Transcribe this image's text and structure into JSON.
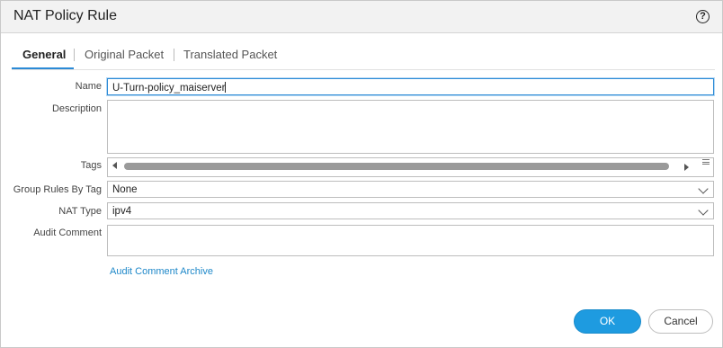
{
  "dialog": {
    "title": "NAT Policy Rule",
    "help_icon": "?"
  },
  "tabs": [
    {
      "label": "General",
      "active": true
    },
    {
      "label": "Original Packet",
      "active": false
    },
    {
      "label": "Translated Packet",
      "active": false
    }
  ],
  "form": {
    "name_label": "Name",
    "name_value": "U-Turn-policy_maiserver",
    "description_label": "Description",
    "description_value": "",
    "tags_label": "Tags",
    "group_rules_label": "Group Rules By Tag",
    "group_rules_value": "None",
    "nat_type_label": "NAT Type",
    "nat_type_value": "ipv4",
    "audit_comment_label": "Audit Comment",
    "audit_comment_value": "",
    "audit_archive_link": "Audit Comment Archive"
  },
  "buttons": {
    "ok_label": "OK",
    "cancel_label": "Cancel"
  },
  "colors": {
    "accent": "#1e9be0",
    "link": "#1e88c9",
    "titlebar": "#f2f2f2"
  },
  "icons": {
    "help": "help-icon",
    "dropdown": "chevron-down-icon",
    "scroll_left": "scroll-left-icon",
    "scroll_right": "scroll-right-icon",
    "menu": "menu-icon"
  }
}
